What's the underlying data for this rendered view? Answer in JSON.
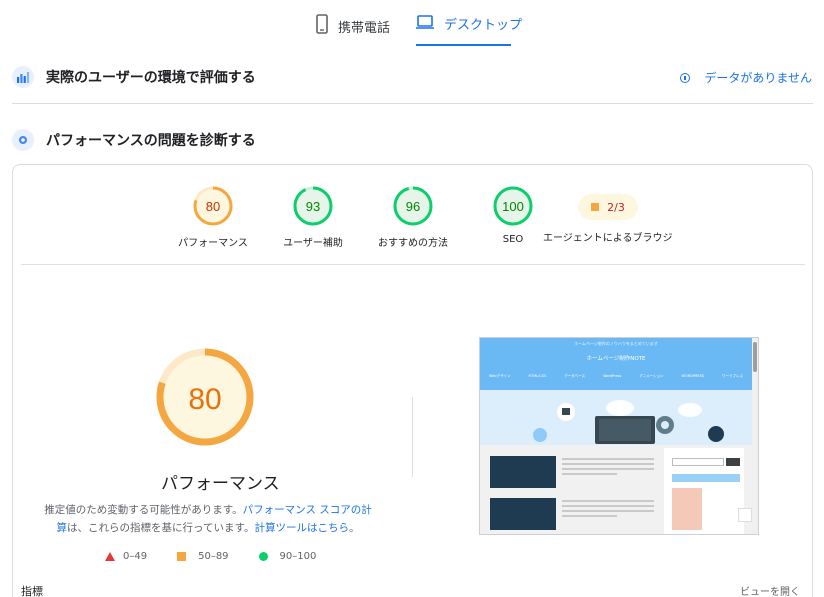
{
  "tabs": {
    "mobile": "携帯電話",
    "desktop": "デスクトップ",
    "active": "desktop",
    "accent_color": "#1a73e8"
  },
  "field_section": {
    "title": "実際のユーザーの環境で評価する",
    "no_data": "データがありません",
    "icon": "field-data-icon"
  },
  "lab_section": {
    "title": "パフォーマンスの問題を診断する",
    "icon": "lighthouse-icon"
  },
  "category_scores": [
    {
      "name": "パフォーマンス",
      "score": 80,
      "color": "#f4a741",
      "text_color": "#c33300"
    },
    {
      "name": "ユーザー補助",
      "score": 93,
      "color": "#0cce6b",
      "text_color": "#008800"
    },
    {
      "name": "おすすめの方法",
      "score": 96,
      "color": "#0cce6b",
      "text_color": "#008800"
    },
    {
      "name": "SEO",
      "score": 100,
      "color": "#0cce6b",
      "text_color": "#008800"
    }
  ],
  "agentic_browsing": {
    "label": "エージェントによるブラウジング",
    "value": "2/3",
    "color": "#f4a741"
  },
  "main_gauge": {
    "score": "80",
    "label": "パフォーマンス",
    "color": "#f4a741",
    "text_color": "#e8710a"
  },
  "description": {
    "part1": "推定値のため変動する可能性があります。",
    "link1": "パフォーマンス スコアの計算",
    "part2": "は、これらの指標を基に行っています。",
    "link2": "計算ツールはこちら",
    "part3": "。"
  },
  "legend": {
    "poor": "0–49",
    "average": "50–89",
    "good": "90–100"
  },
  "metrics": {
    "label": "指標",
    "expand": "ビューを開く"
  },
  "screenshot_thumbnail": {
    "site_title": "ホームページ制作NOTE",
    "subtitle": "ホームページ制作のノウハウをまとめています",
    "nav": [
      "Webデザイン",
      "HTML/CSS",
      "データベース",
      "WordPress",
      "アニメーション",
      "WORDPRESS",
      "ワードプレス"
    ],
    "icon": "website-screenshot"
  }
}
